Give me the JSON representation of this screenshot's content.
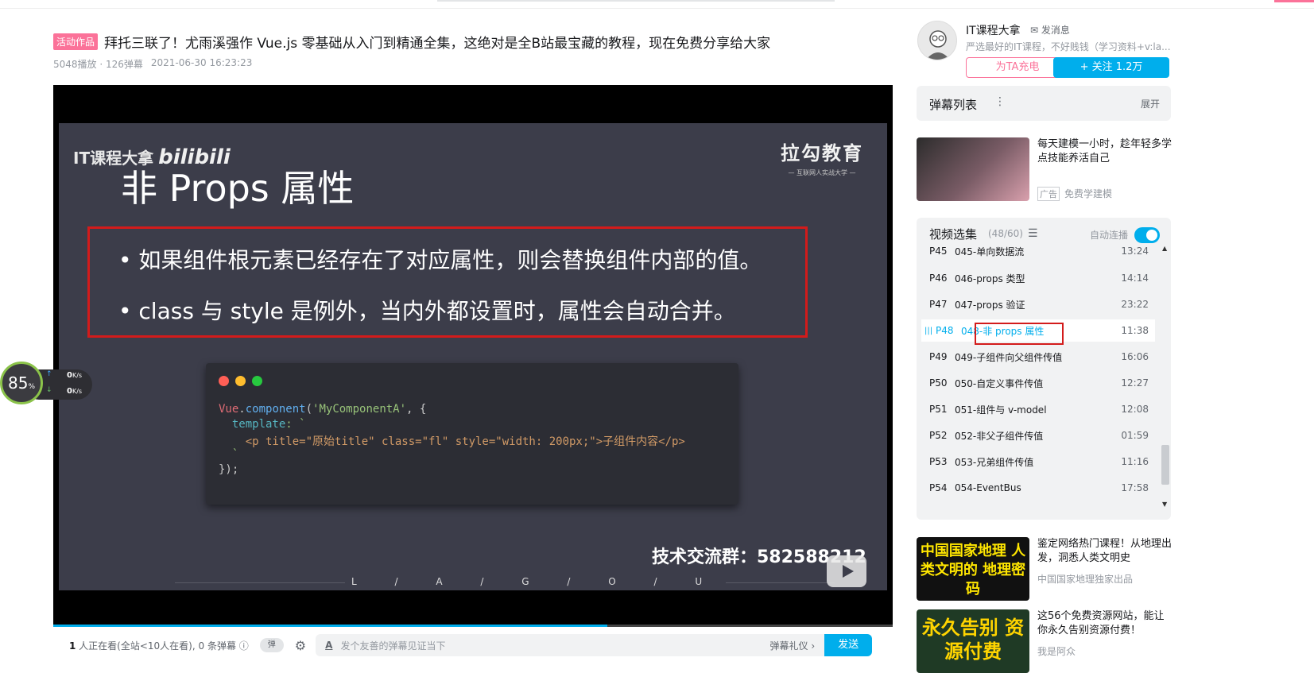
{
  "video": {
    "tag": "活动作品",
    "title": "拜托三联了！尤雨溪强作 Vue.js 零基础从入门到精通全集，这绝对是全B站最宝藏的教程，现在免费分享给大家",
    "plays": "5048播放 · 126弹幕",
    "date": "2021-06-30 16:23:23",
    "progress_fraction": 0.66
  },
  "slide": {
    "watermark": "IT课程大拿",
    "watermark_logo": "bilibili",
    "brand": "拉勾教育",
    "brand_sub": "— 互联网人实战大学 —",
    "title": "非 Props 属性",
    "bullets": [
      "• 如果组件根元素已经存在了对应属性，则会替换组件内部的值。",
      "• class 与 style 是例外，当内外都设置时，属性会自动合并。"
    ],
    "code": {
      "line1_a": "Vue",
      "line1_b": ".",
      "line1_c": "component",
      "line1_d": "(",
      "line1_e": "'MyComponentA'",
      "line1_f": ", {",
      "line2_a": "  template",
      "line2_b": ": `",
      "line3": "    <p title=\"原始title\" class=\"fl\" style=\"width: 200px;\">子组件内容</p>",
      "line4": "  `",
      "line5": "});"
    },
    "group": "技术交流群：582588212",
    "lagou": "L / A / G / O / U"
  },
  "bottom_bar": {
    "viewers_count": "1",
    "viewers_text": " 人正在看(全站<10人在看), 0 条弹幕",
    "toggle_label": "弹",
    "input_placeholder": "发个友善的弹幕见证当下",
    "etiquette": "弹幕礼仪 ›",
    "send": "发送"
  },
  "speed": {
    "percent": "85",
    "percent_unit": "%",
    "up": "0",
    "down": "0",
    "unit": "K/s"
  },
  "uploader": {
    "name": "IT课程大拿",
    "message": "发消息",
    "desc": "严选最好的IT课程，不好贱钱（学习资料+v:la...",
    "charge": "为TA充电",
    "follow": "+ 关注 1.2万"
  },
  "danmu_list": {
    "title": "弹幕列表",
    "expand": "展开"
  },
  "ad": {
    "title": "每天建模一小时，趁年轻多学点技能养活自己",
    "badge": "广告",
    "author": "免费学建模"
  },
  "episodes": {
    "title": "视频选集",
    "count": "(48/60)",
    "autoplay": "自动连播",
    "items": [
      {
        "p": "P45",
        "name": "045-单向数据流",
        "dur": "13:24"
      },
      {
        "p": "P46",
        "name": "046-props 类型",
        "dur": "14:14"
      },
      {
        "p": "P47",
        "name": "047-props 验证",
        "dur": "23:22"
      },
      {
        "p": "P48",
        "name": "048-非 props 属性",
        "dur": "11:38"
      },
      {
        "p": "P49",
        "name": "049-子组件向父组件传值",
        "dur": "16:06"
      },
      {
        "p": "P50",
        "name": "050-自定义事件传值",
        "dur": "12:27"
      },
      {
        "p": "P51",
        "name": "051-组件与 v-model",
        "dur": "12:08"
      },
      {
        "p": "P52",
        "name": "052-非父子组件传值",
        "dur": "01:59"
      },
      {
        "p": "P53",
        "name": "053-兄弟组件传值",
        "dur": "11:16"
      },
      {
        "p": "P54",
        "name": "054-EventBus",
        "dur": "17:58"
      }
    ]
  },
  "recommendations": [
    {
      "thumb_text": "中国国家地理 人类文明的 地理密码",
      "title": "鉴定网络热门课程！从地理出发，洞悉人类文明史",
      "author": "中国国家地理独家出品"
    },
    {
      "thumb_text": "永久告别 资源付费",
      "title": "这56个免费资源网站，能让你永久告别资源付费！",
      "author": "我是阿众"
    }
  ],
  "colors": {
    "accent": "#00aeec",
    "pink": "#fb7299",
    "highlight": "#d31b1b"
  }
}
